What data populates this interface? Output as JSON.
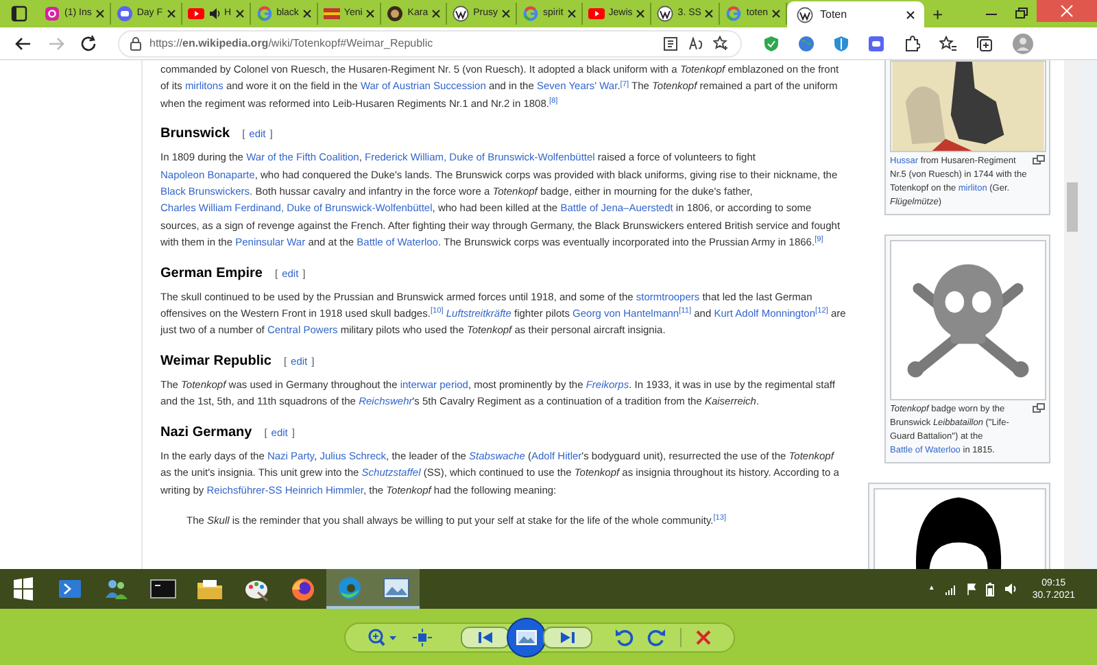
{
  "browser": {
    "tabs": [
      {
        "kind": "instagram",
        "label": "(1) Ins",
        "audio": false,
        "selected": false
      },
      {
        "kind": "discord",
        "label": "Day F",
        "audio": false,
        "selected": false
      },
      {
        "kind": "youtube",
        "label": "H",
        "audio": true,
        "selected": false
      },
      {
        "kind": "google",
        "label": "black",
        "audio": false,
        "selected": false
      },
      {
        "kind": "news",
        "label": "Yeni",
        "audio": false,
        "selected": false
      },
      {
        "kind": "emblem",
        "label": "Kara",
        "audio": false,
        "selected": false
      },
      {
        "kind": "wikipedia",
        "label": "Prusy",
        "audio": false,
        "selected": false
      },
      {
        "kind": "google",
        "label": "spirit",
        "audio": false,
        "selected": false
      },
      {
        "kind": "youtube",
        "label": "Jewis",
        "audio": false,
        "selected": false
      },
      {
        "kind": "wikipedia",
        "label": "3. SS",
        "audio": false,
        "selected": false
      },
      {
        "kind": "google",
        "label": "toten",
        "audio": false,
        "selected": false
      },
      {
        "kind": "wikipedia",
        "label": "Toten",
        "audio": false,
        "selected": true
      }
    ],
    "new_tab": "+",
    "forward": {
      "disabled": true
    },
    "url": "https://**en.wikipedia.org**/wiki/Totenkopf#Weimar_Republic"
  },
  "article": {
    "sections": [
      {
        "paragraphs": [
          [
            {
              "text": "commanded by Colonel von Ruesch, the Husaren-Regiment Nr. 5 (von Ruesch). It adopted a black uniform with a *Totenkopf* emblazoned on the front of its ",
              "link": false
            },
            {
              "text": "mirlitons",
              "link": true
            },
            {
              "text": " and wore it on the field in the ",
              "link": false
            },
            {
              "text": "War of Austrian Succession",
              "link": true
            },
            {
              "text": " and in the ",
              "link": false
            },
            {
              "text": "Seven Years' War",
              "link": true
            },
            {
              "text": ".",
              "link": false
            },
            {
              "text": "$^{[7]}$",
              "link": true
            },
            {
              "text": " The *Totenkopf* remained a part of the uniform when the regiment was reformed into Leib-Husaren Regiments Nr.1 and Nr.2 in 1808.",
              "link": false
            },
            {
              "text": "$^{[8]}$",
              "link": true
            }
          ]
        ]
      },
      {
        "heading": {
          "title": "Brunswick",
          "open": "[",
          "edit": "edit",
          "close": "]"
        },
        "paragraphs": [
          [
            {
              "text": "In 1809 during the ",
              "link": false
            },
            {
              "text": "War of the Fifth Coalition",
              "link": true
            },
            {
              "text": ", ",
              "link": false
            },
            {
              "text": "Frederick William, Duke of Brunswick-Wolfenbüttel",
              "link": true
            },
            {
              "text": " raised a force of volunteers to fight ",
              "link": false
            },
            {
              "text": "Napoleon Bonaparte",
              "link": true
            },
            {
              "text": ", who had conquered the Duke's lands. The Brunswick corps was provided with black uniforms, giving rise to their nickname, the ",
              "link": false
            },
            {
              "text": "Black Brunswickers",
              "link": true
            },
            {
              "text": ". Both hussar cavalry and infantry in the force wore a *Totenkopf* badge, either in mourning for the duke's father, ",
              "link": false
            },
            {
              "text": "Charles William Ferdinand, Duke of Brunswick-Wolfenbüttel",
              "link": true
            },
            {
              "text": ", who had been killed at the ",
              "link": false
            },
            {
              "text": "Battle of Jena–Auerstedt",
              "link": true
            },
            {
              "text": " in 1806, or according to some sources, as a sign of revenge against the French. After fighting their way through Germany, the Black Brunswickers entered British service and fought with them in the ",
              "link": false
            },
            {
              "text": "Peninsular War",
              "link": true
            },
            {
              "text": " and at the ",
              "link": false
            },
            {
              "text": "Battle of Waterloo",
              "link": true
            },
            {
              "text": ". The Brunswick corps was eventually incorporated into the Prussian Army in 1866.",
              "link": false
            },
            {
              "text": "$^{[9]}$",
              "link": true
            }
          ]
        ]
      },
      {
        "heading": {
          "title": "German Empire",
          "open": "[",
          "edit": "edit",
          "close": "]"
        },
        "paragraphs": [
          [
            {
              "text": "The skull continued to be used by the Prussian and Brunswick armed forces until 1918, and some of the ",
              "link": false
            },
            {
              "text": "stormtroopers",
              "link": true
            },
            {
              "text": " that led the last German offensives on the Western Front in 1918 used skull badges.",
              "link": false
            },
            {
              "text": "$^{[10]}$",
              "link": true
            },
            {
              "text": " *Luftstreitkräfte*",
              "link": true
            },
            {
              "text": " fighter pilots ",
              "link": false
            },
            {
              "text": "Georg von Hantelmann",
              "link": true
            },
            {
              "text": "$^{[11]}$",
              "link": true
            },
            {
              "text": " and ",
              "link": false
            },
            {
              "text": "Kurt Adolf Monnington",
              "link": true
            },
            {
              "text": "$^{[12]}$",
              "link": true
            },
            {
              "text": " are just two of a number of ",
              "link": false
            },
            {
              "text": "Central Powers",
              "link": true
            },
            {
              "text": " military pilots who used the *Totenkopf* as their personal aircraft insignia.",
              "link": false
            }
          ]
        ]
      },
      {
        "heading": {
          "title": "Weimar Republic",
          "open": "[",
          "edit": "edit",
          "close": "]"
        },
        "paragraphs": [
          [
            {
              "text": "The *Totenkopf* was used in Germany throughout the ",
              "link": false
            },
            {
              "text": "interwar period",
              "link": true
            },
            {
              "text": ", most prominently by the ",
              "link": false
            },
            {
              "text": "*Freikorps*",
              "link": true
            },
            {
              "text": ". In 1933, it was in use by the regimental staff and the 1st, 5th, and 11th squadrons of the ",
              "link": false
            },
            {
              "text": "*Reichswehr*",
              "link": true
            },
            {
              "text": "'s 5th Cavalry Regiment as a continuation of a tradition from the *Kaiserreich*.",
              "link": false
            }
          ]
        ]
      },
      {
        "heading": {
          "title": "Nazi Germany",
          "open": "[",
          "edit": "edit",
          "close": "]"
        },
        "paragraphs": [
          [
            {
              "text": "In the early days of the ",
              "link": false
            },
            {
              "text": "Nazi Party",
              "link": true
            },
            {
              "text": ", ",
              "link": false
            },
            {
              "text": "Julius Schreck",
              "link": true
            },
            {
              "text": ", the leader of the ",
              "link": false
            },
            {
              "text": "*Stabswache*",
              "link": true
            },
            {
              "text": " (",
              "link": false
            },
            {
              "text": "Adolf Hitler",
              "link": true
            },
            {
              "text": "'s bodyguard unit), resurrected the use of the *Totenkopf* as the unit's insignia. This unit grew into the ",
              "link": false
            },
            {
              "text": "*Schutzstaffel*",
              "link": true
            },
            {
              "text": " (SS), which continued to use the *Totenkopf* as insignia throughout its history. According to a writing by ",
              "link": false
            },
            {
              "text": "Reichsführer-SS Heinrich Himmler",
              "link": true
            },
            {
              "text": ", the *Totenkopf* had the following meaning:",
              "link": false
            }
          ]
        ],
        "quote": [
          {
            "text": "The *Skull* is the reminder that you shall always be willing to put your self at stake for the life of the whole community.",
            "link": false
          },
          {
            "text": "$^{[13]}$",
            "link": true
          }
        ]
      }
    ]
  },
  "figures": [
    {
      "kind": "illustration",
      "caption": [
        {
          "text": "Hussar",
          "link": true
        },
        {
          "text": " from Husaren-Regiment Nr.5 (von Ruesch) in 1744 with the Totenkopf on the ",
          "link": false
        },
        {
          "text": "mirliton",
          "link": true
        },
        {
          "text": " (Ger. *Flügelmütze*)",
          "link": false
        }
      ]
    },
    {
      "kind": "badge-photo",
      "caption": [
        {
          "text": "*Totenkopf* badge worn by the Brunswick *Leibbataillon* (\"Life-Guard Battalion\") at the ",
          "link": false
        },
        {
          "text": "Battle of Waterloo",
          "link": true
        },
        {
          "text": " in 1815.",
          "link": false
        }
      ]
    },
    {
      "kind": "silhouette"
    }
  ],
  "taskbar": {
    "apps": [
      {
        "kind": "powershell",
        "highlighted": false
      },
      {
        "kind": "people",
        "highlighted": false
      },
      {
        "kind": "terminal",
        "highlighted": false
      },
      {
        "kind": "folder",
        "highlighted": false
      },
      {
        "kind": "paint",
        "highlighted": false
      },
      {
        "kind": "firefox",
        "highlighted": false
      },
      {
        "kind": "edge",
        "highlighted": true
      },
      {
        "kind": "photos",
        "highlighted": true
      }
    ],
    "tray_arrow": "▲",
    "time": "09:15",
    "date": "30.7.2021"
  }
}
